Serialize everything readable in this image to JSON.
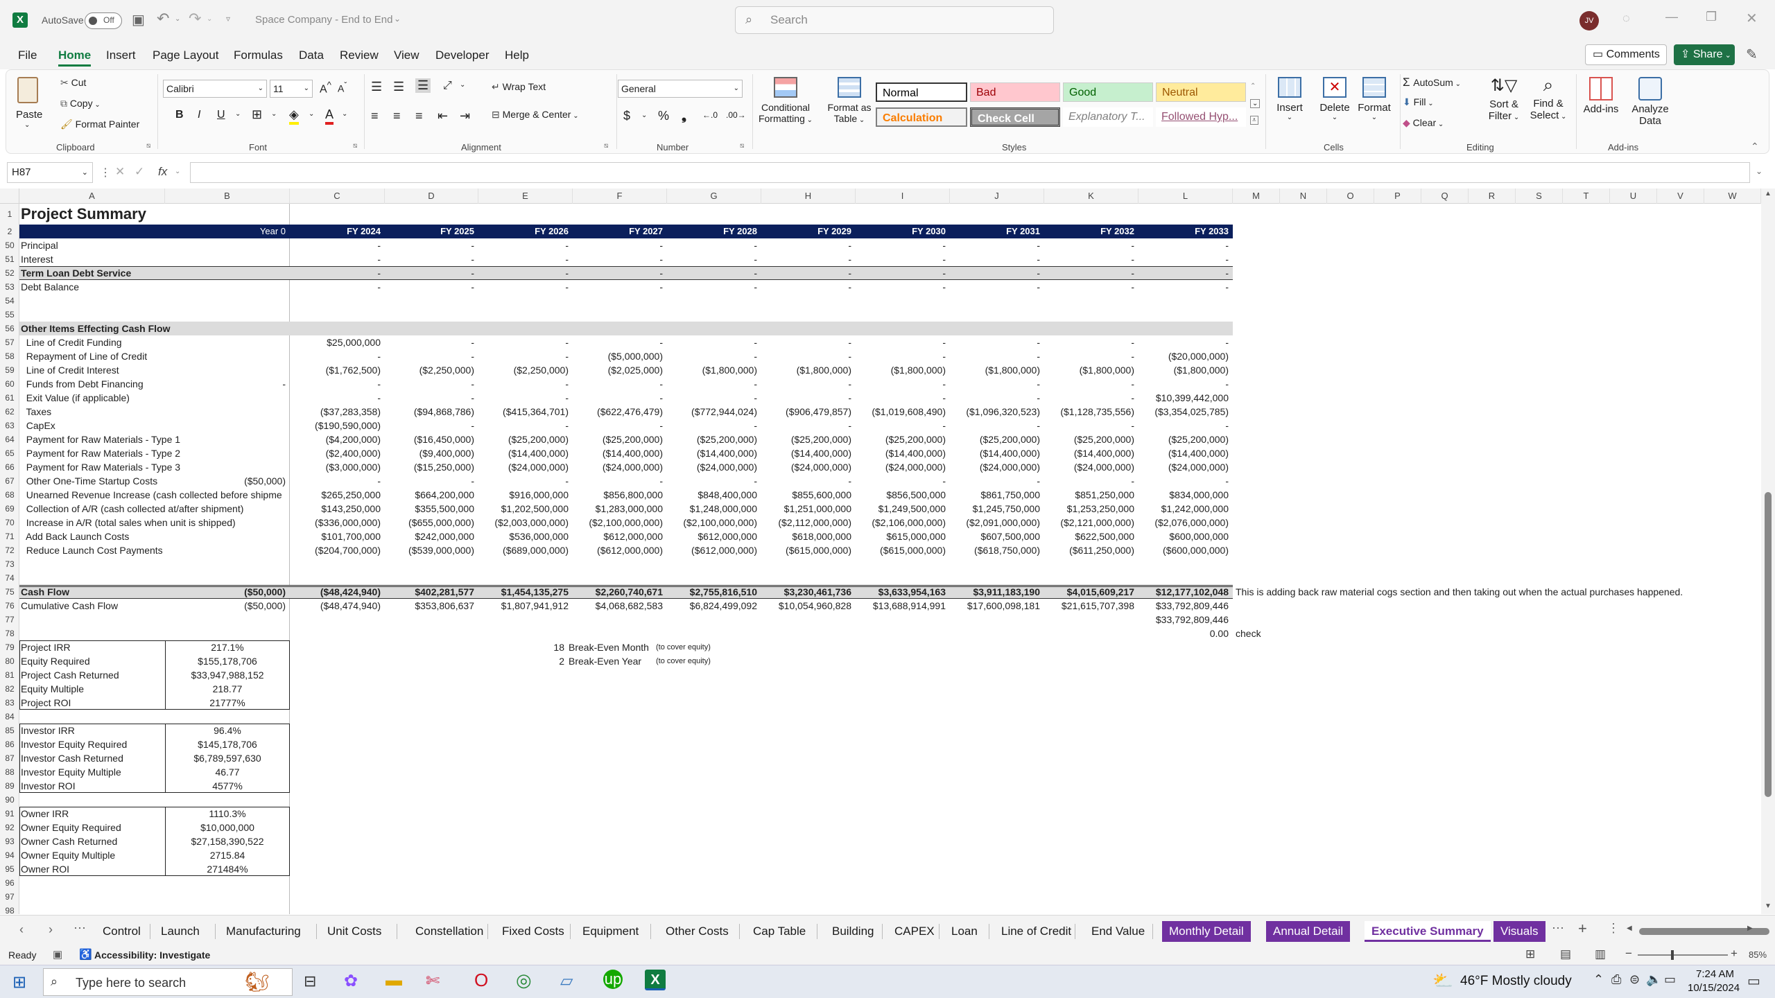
{
  "titlebar": {
    "autosave_label": "AutoSave",
    "autosave_state": "Off",
    "doc_title": "Space Company - End to End",
    "search_placeholder": "Search",
    "user_initials": "JV"
  },
  "menu": [
    "File",
    "Home",
    "Insert",
    "Page Layout",
    "Formulas",
    "Data",
    "Review",
    "View",
    "Developer",
    "Help"
  ],
  "menu_right": {
    "comments": "Comments",
    "share": "Share"
  },
  "ribbon": {
    "clipboard": {
      "paste": "Paste",
      "cut": "Cut",
      "copy": "Copy",
      "format_painter": "Format Painter",
      "group": "Clipboard"
    },
    "font": {
      "name": "Calibri",
      "size": "11",
      "group": "Font"
    },
    "alignment": {
      "wrap": "Wrap Text",
      "merge": "Merge & Center",
      "group": "Alignment"
    },
    "number": {
      "format": "General",
      "group": "Number"
    },
    "styles": {
      "cond_line1": "Conditional",
      "cond_line2": "Formatting",
      "fmt_line1": "Format as",
      "fmt_line2": "Table",
      "normal": "Normal",
      "bad": "Bad",
      "good": "Good",
      "neutral": "Neutral",
      "calculation": "Calculation",
      "check_cell": "Check Cell",
      "explanatory": "Explanatory T...",
      "followed": "Followed Hyp...",
      "group": "Styles"
    },
    "cells": {
      "insert": "Insert",
      "delete": "Delete",
      "format": "Format",
      "group": "Cells"
    },
    "editing": {
      "autosum": "AutoSum",
      "fill": "Fill",
      "clear": "Clear",
      "sort_line1": "Sort &",
      "sort_line2": "Filter",
      "find_line1": "Find &",
      "find_line2": "Select",
      "group": "Editing"
    },
    "addins": {
      "addins": "Add-ins",
      "analyze_line1": "Analyze",
      "analyze_line2": "Data",
      "group": "Add-ins"
    }
  },
  "formula_bar": {
    "name_box": "H87",
    "fx": "fx",
    "content": ""
  },
  "columns": [
    "A",
    "B",
    "C",
    "D",
    "E",
    "F",
    "G",
    "H",
    "I",
    "J",
    "K",
    "L",
    "M",
    "N",
    "O",
    "P",
    "Q",
    "R",
    "S",
    "T",
    "U",
    "V",
    "W"
  ],
  "rows": [
    {
      "n": "1",
      "a": "Project Summary",
      "style": "title"
    },
    {
      "n": "2",
      "b": "Year 0",
      "c": "FY 2024",
      "d": "FY 2025",
      "e": "FY 2026",
      "f": "FY 2027",
      "g": "FY 2028",
      "h": "FY 2029",
      "i": "FY 2030",
      "j": "FY 2031",
      "k": "FY 2032",
      "l": "FY 2033",
      "style": "header"
    },
    {
      "n": "50",
      "a": "Principal",
      "c": "-",
      "d": "-",
      "e": "-",
      "f": "-",
      "g": "-",
      "h": "-",
      "i": "-",
      "j": "-",
      "k": "-",
      "l": "-"
    },
    {
      "n": "51",
      "a": "Interest",
      "c": "-",
      "d": "-",
      "e": "-",
      "f": "-",
      "g": "-",
      "h": "-",
      "i": "-",
      "j": "-",
      "k": "-",
      "l": "-"
    },
    {
      "n": "52",
      "a": "Term Loan Debt Service",
      "c": "-",
      "d": "-",
      "e": "-",
      "f": "-",
      "g": "-",
      "h": "-",
      "i": "-",
      "j": "-",
      "k": "-",
      "l": "-",
      "style": "boxed"
    },
    {
      "n": "53",
      "a": "Debt Balance",
      "c": "-",
      "d": "-",
      "e": "-",
      "f": "-",
      "g": "-",
      "h": "-",
      "i": "-",
      "j": "-",
      "k": "-",
      "l": "-"
    },
    {
      "n": "54"
    },
    {
      "n": "55"
    },
    {
      "n": "56",
      "a": "Other Items Effecting Cash Flow",
      "style": "section"
    },
    {
      "n": "57",
      "a": "  Line of Credit Funding",
      "c": "$25,000,000",
      "d": "-",
      "e": "-",
      "f": "-",
      "g": "-",
      "h": "-",
      "i": "-",
      "j": "-",
      "k": "-",
      "l": "-"
    },
    {
      "n": "58",
      "a": "  Repayment of Line of Credit",
      "c": "-",
      "d": "-",
      "e": "-",
      "f": "($5,000,000)",
      "g": "-",
      "h": "-",
      "i": "-",
      "j": "-",
      "k": "-",
      "l": "($20,000,000)"
    },
    {
      "n": "59",
      "a": "  Line of Credit Interest",
      "c": "($1,762,500)",
      "d": "($2,250,000)",
      "e": "($2,250,000)",
      "f": "($2,025,000)",
      "g": "($1,800,000)",
      "h": "($1,800,000)",
      "i": "($1,800,000)",
      "j": "($1,800,000)",
      "k": "($1,800,000)",
      "l": "($1,800,000)"
    },
    {
      "n": "60",
      "a": "  Funds from Debt Financing",
      "b": "-",
      "c": "-",
      "d": "-",
      "e": "-",
      "f": "-",
      "g": "-",
      "h": "-",
      "i": "-",
      "j": "-",
      "k": "-",
      "l": "-"
    },
    {
      "n": "61",
      "a": "  Exit Value (if applicable)",
      "c": "-",
      "d": "-",
      "e": "-",
      "f": "-",
      "g": "-",
      "h": "-",
      "i": "-",
      "j": "-",
      "k": "-",
      "l": "$10,399,442,000"
    },
    {
      "n": "62",
      "a": "  Taxes",
      "c": "($37,283,358)",
      "d": "($94,868,786)",
      "e": "($415,364,701)",
      "f": "($622,476,479)",
      "g": "($772,944,024)",
      "h": "($906,479,857)",
      "i": "($1,019,608,490)",
      "j": "($1,096,320,523)",
      "k": "($1,128,735,556)",
      "l": "($3,354,025,785)"
    },
    {
      "n": "63",
      "a": "  CapEx",
      "c": "($190,590,000)",
      "d": "-",
      "e": "-",
      "f": "-",
      "g": "-",
      "h": "-",
      "i": "-",
      "j": "-",
      "k": "-",
      "l": "-"
    },
    {
      "n": "64",
      "a": "  Payment for Raw Materials - Type 1",
      "c": "($4,200,000)",
      "d": "($16,450,000)",
      "e": "($25,200,000)",
      "f": "($25,200,000)",
      "g": "($25,200,000)",
      "h": "($25,200,000)",
      "i": "($25,200,000)",
      "j": "($25,200,000)",
      "k": "($25,200,000)",
      "l": "($25,200,000)"
    },
    {
      "n": "65",
      "a": "  Payment for Raw Materials - Type 2",
      "c": "($2,400,000)",
      "d": "($9,400,000)",
      "e": "($14,400,000)",
      "f": "($14,400,000)",
      "g": "($14,400,000)",
      "h": "($14,400,000)",
      "i": "($14,400,000)",
      "j": "($14,400,000)",
      "k": "($14,400,000)",
      "l": "($14,400,000)"
    },
    {
      "n": "66",
      "a": "  Payment for Raw Materials - Type 3",
      "c": "($3,000,000)",
      "d": "($15,250,000)",
      "e": "($24,000,000)",
      "f": "($24,000,000)",
      "g": "($24,000,000)",
      "h": "($24,000,000)",
      "i": "($24,000,000)",
      "j": "($24,000,000)",
      "k": "($24,000,000)",
      "l": "($24,000,000)"
    },
    {
      "n": "67",
      "a": "  Other One-Time Startup Costs",
      "b": "($50,000)",
      "c": "-",
      "d": "-",
      "e": "-",
      "f": "-",
      "g": "-",
      "h": "-",
      "i": "-",
      "j": "-",
      "k": "-",
      "l": "-"
    },
    {
      "n": "68",
      "a": "  Unearned Revenue Increase (cash collected before shipme",
      "c": "$265,250,000",
      "d": "$664,200,000",
      "e": "$916,000,000",
      "f": "$856,800,000",
      "g": "$848,400,000",
      "h": "$855,600,000",
      "i": "$856,500,000",
      "j": "$861,750,000",
      "k": "$851,250,000",
      "l": "$834,000,000"
    },
    {
      "n": "69",
      "a": "  Collection of A/R (cash collected at/after shipment)",
      "c": "$143,250,000",
      "d": "$355,500,000",
      "e": "$1,202,500,000",
      "f": "$1,283,000,000",
      "g": "$1,248,000,000",
      "h": "$1,251,000,000",
      "i": "$1,249,500,000",
      "j": "$1,245,750,000",
      "k": "$1,253,250,000",
      "l": "$1,242,000,000"
    },
    {
      "n": "70",
      "a": "  Increase in A/R (total sales when unit is shipped)",
      "c": "($336,000,000)",
      "d": "($655,000,000)",
      "e": "($2,003,000,000)",
      "f": "($2,100,000,000)",
      "g": "($2,100,000,000)",
      "h": "($2,112,000,000)",
      "i": "($2,106,000,000)",
      "j": "($2,091,000,000)",
      "k": "($2,121,000,000)",
      "l": "($2,076,000,000)"
    },
    {
      "n": "71",
      "a": "  Add Back Launch Costs",
      "c": "$101,700,000",
      "d": "$242,000,000",
      "e": "$536,000,000",
      "f": "$612,000,000",
      "g": "$612,000,000",
      "h": "$618,000,000",
      "i": "$615,000,000",
      "j": "$607,500,000",
      "k": "$622,500,000",
      "l": "$600,000,000"
    },
    {
      "n": "72",
      "a": "  Reduce Launch Cost Payments",
      "c": "($204,700,000)",
      "d": "($539,000,000)",
      "e": "($689,000,000)",
      "f": "($612,000,000)",
      "g": "($612,000,000)",
      "h": "($615,000,000)",
      "i": "($615,000,000)",
      "j": "($618,750,000)",
      "k": "($611,250,000)",
      "l": "($600,000,000)"
    },
    {
      "n": "73"
    },
    {
      "n": "74"
    },
    {
      "n": "75",
      "a": "Cash Flow",
      "b": "($50,000)",
      "c": "($48,424,940)",
      "d": "$402,281,577",
      "e": "$1,454,135,275",
      "f": "$2,260,740,671",
      "g": "$2,755,816,510",
      "h": "$3,230,461,736",
      "i": "$3,633,954,163",
      "j": "$3,911,183,190",
      "k": "$4,015,609,217",
      "l": "$12,177,102,048",
      "m": "This is adding back raw material cogs section and then taking out when the actual purchases happened.",
      "style": "cashflow"
    },
    {
      "n": "76",
      "a": "Cumulative Cash Flow",
      "b": "($50,000)",
      "c": "($48,474,940)",
      "d": "$353,806,637",
      "e": "$1,807,941,912",
      "f": "$4,068,682,583",
      "g": "$6,824,499,092",
      "h": "$10,054,960,828",
      "i": "$13,688,914,991",
      "j": "$17,600,098,181",
      "k": "$21,615,707,398",
      "l": "$33,792,809,446"
    },
    {
      "n": "77",
      "l": "$33,792,809,446"
    },
    {
      "n": "78",
      "l": "0.00",
      "m": "check"
    },
    {
      "n": "79",
      "a": "Project IRR",
      "b": "217.1%",
      "be_num": "18",
      "be_label": "Break-Even Month",
      "be_note": "(to cover equity)",
      "style": "box_top"
    },
    {
      "n": "80",
      "a": "Equity Required",
      "b": "$155,178,706",
      "be_num": "2",
      "be_label": "Break-Even Year",
      "be_note": "(to cover equity)",
      "style": "box"
    },
    {
      "n": "81",
      "a": "Project Cash Returned",
      "b": "$33,947,988,152",
      "style": "box"
    },
    {
      "n": "82",
      "a": "Equity Multiple",
      "b": "218.77",
      "style": "box"
    },
    {
      "n": "83",
      "a": "Project ROI",
      "b": "21777%",
      "style": "box_bottom"
    },
    {
      "n": "84"
    },
    {
      "n": "85",
      "a": "Investor IRR",
      "b": "96.4%",
      "style": "box_top"
    },
    {
      "n": "86",
      "a": "Investor Equity Required",
      "b": "$145,178,706",
      "style": "box"
    },
    {
      "n": "87",
      "a": "Investor Cash Returned",
      "b": "$6,789,597,630",
      "style": "box"
    },
    {
      "n": "88",
      "a": "Investor Equity Multiple",
      "b": "46.77",
      "style": "box"
    },
    {
      "n": "89",
      "a": "Investor ROI",
      "b": "4577%",
      "style": "box_bottom"
    },
    {
      "n": "90"
    },
    {
      "n": "91",
      "a": "Owner IRR",
      "b": "1110.3%",
      "style": "box_top"
    },
    {
      "n": "92",
      "a": "Owner Equity Required",
      "b": "$10,000,000",
      "style": "box"
    },
    {
      "n": "93",
      "a": "Owner Cash Returned",
      "b": "$27,158,390,522",
      "style": "box"
    },
    {
      "n": "94",
      "a": "Owner Equity Multiple",
      "b": "2715.84",
      "style": "box"
    },
    {
      "n": "95",
      "a": "Owner ROI",
      "b": "271484%",
      "style": "box_bottom"
    },
    {
      "n": "96"
    },
    {
      "n": "97"
    },
    {
      "n": "98"
    }
  ],
  "sheet_tabs": [
    {
      "label": "Control",
      "kind": "normal"
    },
    {
      "label": "Launch",
      "kind": "normal"
    },
    {
      "label": "Manufacturing",
      "kind": "normal"
    },
    {
      "label": "Unit Costs",
      "kind": "normal"
    },
    {
      "label": "Constellation",
      "kind": "normal"
    },
    {
      "label": "Fixed Costs",
      "kind": "normal"
    },
    {
      "label": "Equipment",
      "kind": "normal"
    },
    {
      "label": "Other Costs",
      "kind": "normal"
    },
    {
      "label": "Cap Table",
      "kind": "normal"
    },
    {
      "label": "Building",
      "kind": "normal"
    },
    {
      "label": "CAPEX",
      "kind": "normal"
    },
    {
      "label": "Loan",
      "kind": "normal"
    },
    {
      "label": "Line of Credit",
      "kind": "normal"
    },
    {
      "label": "End Value",
      "kind": "normal"
    },
    {
      "label": "Monthly Detail",
      "kind": "purple"
    },
    {
      "label": "Annual Detail",
      "kind": "purple"
    },
    {
      "label": "Executive Summary",
      "kind": "active"
    },
    {
      "label": "Visuals",
      "kind": "purple"
    }
  ],
  "status": {
    "ready": "Ready",
    "accessibility": "Accessibility: Investigate",
    "zoom": "85%"
  },
  "taskbar": {
    "search_placeholder": "Type here to search",
    "weather": "46°F  Mostly cloudy",
    "time": "7:24 AM",
    "date": "10/15/2024"
  },
  "colors": {
    "excel_green": "#107c41",
    "header_navy": "#0b1f5c",
    "purple_tab": "#7030a0",
    "share_green": "#1e7145"
  }
}
